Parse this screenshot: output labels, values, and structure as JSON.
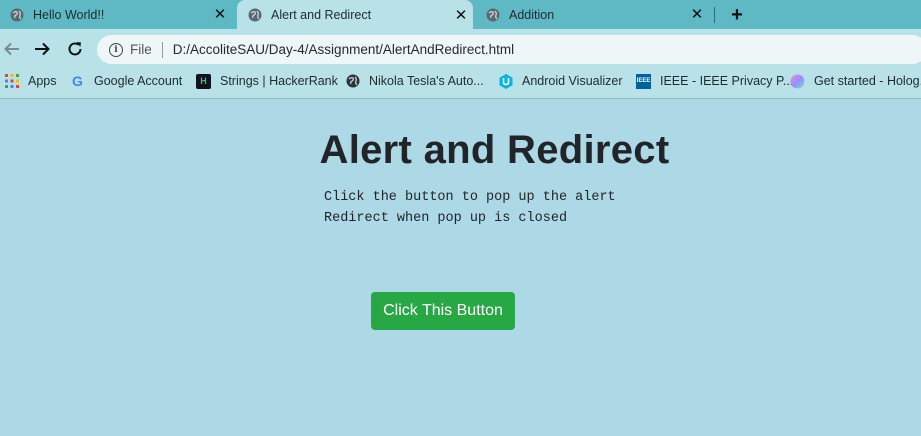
{
  "tabs": [
    {
      "title": "Hello World!!",
      "icon": "globe-icon",
      "active": false
    },
    {
      "title": "Alert and Redirect",
      "icon": "globe-icon",
      "active": true
    },
    {
      "title": "Addition",
      "icon": "globe-icon",
      "active": false
    }
  ],
  "tab_close_glyph": "✕",
  "new_tab_glyph": "+",
  "address_bar": {
    "scheme_label": "File",
    "url": "D:/AccoliteSAU/Day-4/Assignment/AlertAndRedirect.html"
  },
  "bookmarks": [
    {
      "label": "Apps",
      "icon": "apps-grid-icon"
    },
    {
      "label": "Google Account",
      "icon": "google-icon"
    },
    {
      "label": "Strings | HackerRank",
      "icon": "hackerrank-icon"
    },
    {
      "label": "Nikola Tesla's Auto...",
      "icon": "globe-icon"
    },
    {
      "label": "Android Visualizer",
      "icon": "udacity-icon"
    },
    {
      "label": "IEEE - IEEE Privacy P...",
      "icon": "ieee-icon"
    },
    {
      "label": "Get started - Holog...",
      "icon": "holographic-icon"
    }
  ],
  "page": {
    "title": "Alert and Redirect",
    "lines": [
      "Click the button to pop up the alert",
      "Redirect when pop up is closed"
    ],
    "button_label": "Click This Button"
  },
  "colors": {
    "page_background": "#add8e6",
    "tab_strip": "#5fb9c5",
    "toolbar": "#b8e2e8",
    "button": "#28a745"
  }
}
